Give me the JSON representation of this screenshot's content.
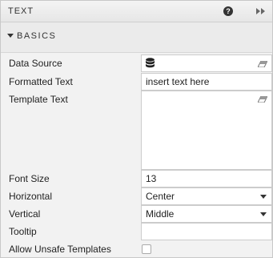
{
  "panel": {
    "title": "TEXT",
    "help_glyph": "?",
    "help_icon": "help-circle-icon",
    "collapse_icon": "double-chevron-right-icon"
  },
  "section": {
    "label": "BASICS",
    "caret_icon": "caret-down-icon"
  },
  "fields": {
    "data_source": {
      "label": "Data Source",
      "icon": "database-icon",
      "action_icon": "eraser-icon"
    },
    "formatted_text": {
      "label": "Formatted Text",
      "value": "insert text here"
    },
    "template_text": {
      "label": "Template Text",
      "value": "",
      "action_icon": "eraser-icon"
    },
    "font_size": {
      "label": "Font Size",
      "value": "13"
    },
    "horizontal": {
      "label": "Horizontal",
      "value": "Center"
    },
    "vertical": {
      "label": "Vertical",
      "value": "Middle"
    },
    "tooltip": {
      "label": "Tooltip",
      "value": ""
    },
    "allow_unsafe": {
      "label": "Allow Unsafe Templates",
      "checked": false
    }
  },
  "colors": {
    "panel_bg": "#f2f2f2",
    "border": "#cccccc",
    "text": "#222222"
  }
}
